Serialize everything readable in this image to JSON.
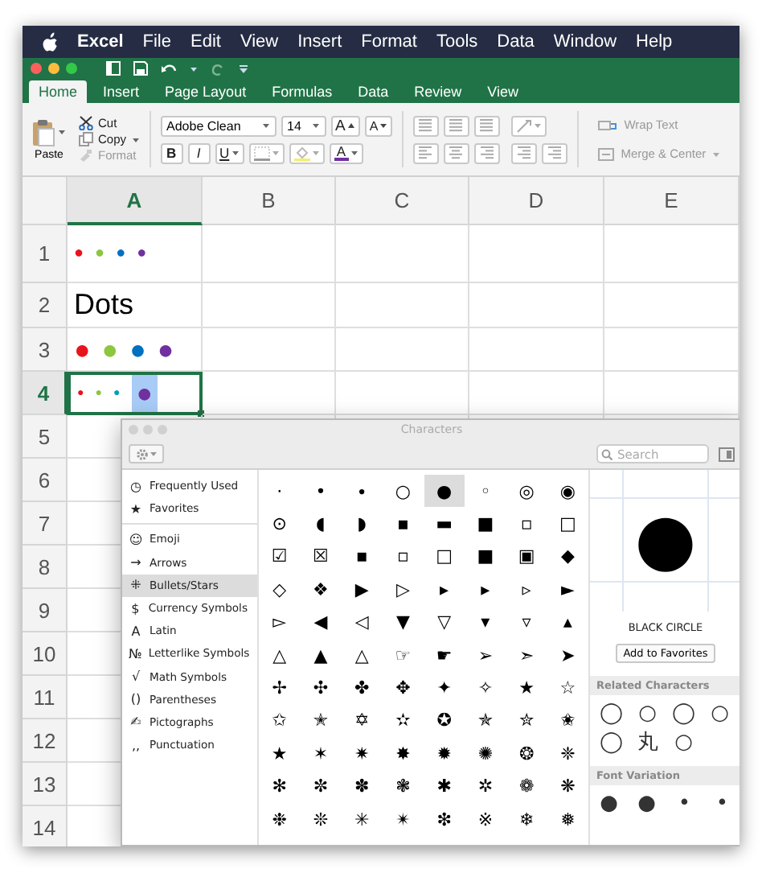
{
  "menu_bar": {
    "items": [
      {
        "label": "Excel",
        "kind": "app"
      },
      {
        "label": "File",
        "kind": "menu"
      },
      {
        "label": "Edit",
        "kind": "menu"
      },
      {
        "label": "View",
        "kind": "menu"
      },
      {
        "label": "Insert",
        "kind": "menu"
      },
      {
        "label": "Format",
        "kind": "menu"
      },
      {
        "label": "Tools",
        "kind": "menu"
      },
      {
        "label": "Data",
        "kind": "menu"
      },
      {
        "label": "Window",
        "kind": "menu"
      },
      {
        "label": "Help",
        "kind": "menu"
      }
    ]
  },
  "ribbon": {
    "tabs": [
      {
        "label": "Home",
        "selected": true
      },
      {
        "label": "Insert",
        "selected": false
      },
      {
        "label": "Page Layout",
        "selected": false
      },
      {
        "label": "Formulas",
        "selected": false
      },
      {
        "label": "Data",
        "selected": false
      },
      {
        "label": "Review",
        "selected": false
      },
      {
        "label": "View",
        "selected": false
      }
    ],
    "clipboard": {
      "paste": "Paste",
      "cut": "Cut",
      "copy": "Copy",
      "format": "Format"
    },
    "font": {
      "name": "Adobe Clean",
      "size": "14",
      "grow": "A",
      "shrink": "A",
      "bold": "B",
      "italic": "I",
      "underline": "U",
      "font_color": "A"
    },
    "wrap_text": "Wrap Text",
    "merge_center": "Merge & Center"
  },
  "sheet": {
    "columns": [
      {
        "label": "A",
        "selected": true
      },
      {
        "label": "B",
        "selected": false
      },
      {
        "label": "C",
        "selected": false
      },
      {
        "label": "D",
        "selected": false
      },
      {
        "label": "E",
        "selected": false
      }
    ],
    "rows": [
      {
        "label": "1",
        "selected": false,
        "cell": {
          "kind": "dots",
          "dots": [
            {
              "glyph": "●",
              "kind": "small",
              "color": "#e8141c"
            },
            {
              "glyph": "●",
              "kind": "small",
              "color": "#8dc63f"
            },
            {
              "glyph": "●",
              "kind": "small",
              "color": "#0070c0"
            },
            {
              "glyph": "●",
              "kind": "small",
              "color": "#7030a0"
            }
          ]
        }
      },
      {
        "label": "2",
        "selected": false,
        "cell": {
          "kind": "text",
          "text": "Dots"
        }
      },
      {
        "label": "3",
        "selected": false,
        "cell": {
          "kind": "dots",
          "dots": [
            {
              "glyph": "●",
              "kind": "large",
              "color": "#e8141c"
            },
            {
              "glyph": "●",
              "kind": "large",
              "color": "#8dc63f"
            },
            {
              "glyph": "●",
              "kind": "large",
              "color": "#0070c0"
            },
            {
              "glyph": "●",
              "kind": "large",
              "color": "#7030a0"
            }
          ]
        }
      },
      {
        "label": "4",
        "selected": true,
        "cell": {
          "kind": "dots",
          "dots": [
            {
              "glyph": "●",
              "kind": "tiny",
              "color": "#e8141c",
              "selected": false
            },
            {
              "glyph": "●",
              "kind": "tiny",
              "color": "#8dc63f",
              "selected": false
            },
            {
              "glyph": "●",
              "kind": "tiny",
              "color": "#00a0b8",
              "selected": false
            },
            {
              "glyph": "●",
              "kind": "large",
              "color": "#7030a0",
              "selected": true
            }
          ]
        }
      },
      {
        "label": "5",
        "selected": false
      },
      {
        "label": "6",
        "selected": false
      },
      {
        "label": "7",
        "selected": false
      },
      {
        "label": "8",
        "selected": false
      },
      {
        "label": "9",
        "selected": false
      },
      {
        "label": "10",
        "selected": false
      },
      {
        "label": "11",
        "selected": false
      },
      {
        "label": "12",
        "selected": false
      },
      {
        "label": "13",
        "selected": false
      },
      {
        "label": "14",
        "selected": false
      }
    ]
  },
  "characters": {
    "title": "Characters",
    "search_placeholder": "Search",
    "pinned": [
      {
        "icon": "◷",
        "label": "Frequently Used",
        "selected": false
      },
      {
        "icon": "★",
        "label": "Favorites",
        "selected": false
      }
    ],
    "categories": [
      {
        "icon": "☺",
        "label": "Emoji",
        "selected": false
      },
      {
        "icon": "→",
        "label": "Arrows",
        "selected": false
      },
      {
        "icon": "⁜",
        "label": "Bullets/Stars",
        "selected": true
      },
      {
        "icon": "$",
        "label": "Currency Symbols",
        "selected": false
      },
      {
        "icon": "A",
        "label": "Latin",
        "selected": false
      },
      {
        "icon": "№",
        "label": "Letterlike Symbols",
        "selected": false
      },
      {
        "icon": "√",
        "label": "Math Symbols",
        "selected": false
      },
      {
        "icon": "()",
        "label": "Parentheses",
        "selected": false
      },
      {
        "icon": "✍",
        "label": "Pictographs",
        "selected": false
      },
      {
        "icon": ",,",
        "label": "Punctuation",
        "selected": false
      }
    ],
    "grid": [
      [
        {
          "glyph": "·",
          "selected": false
        },
        {
          "glyph": "•",
          "selected": false
        },
        {
          "glyph": "∙",
          "selected": false
        },
        {
          "glyph": "○",
          "selected": false
        },
        {
          "glyph": "●",
          "selected": true
        },
        {
          "glyph": "◦",
          "selected": false
        },
        {
          "glyph": "◎",
          "selected": false
        },
        {
          "glyph": "◉",
          "selected": false
        }
      ],
      [
        {
          "glyph": "⊙",
          "selected": false
        },
        {
          "glyph": "◖",
          "selected": false
        },
        {
          "glyph": "◗",
          "selected": false
        },
        {
          "glyph": "▪",
          "selected": false
        },
        {
          "glyph": "▬",
          "selected": false
        },
        {
          "glyph": "■",
          "selected": false
        },
        {
          "glyph": "▫",
          "selected": false
        },
        {
          "glyph": "□",
          "selected": false
        }
      ],
      [
        {
          "glyph": "☑",
          "selected": false
        },
        {
          "glyph": "☒",
          "selected": false
        },
        {
          "glyph": "▪",
          "selected": false
        },
        {
          "glyph": "▫",
          "selected": false
        },
        {
          "glyph": "□",
          "selected": false
        },
        {
          "glyph": "■",
          "selected": false
        },
        {
          "glyph": "▣",
          "selected": false
        },
        {
          "glyph": "◆",
          "selected": false
        }
      ],
      [
        {
          "glyph": "◇",
          "selected": false
        },
        {
          "glyph": "❖",
          "selected": false
        },
        {
          "glyph": "▶",
          "selected": false
        },
        {
          "glyph": "▷",
          "selected": false
        },
        {
          "glyph": "▸",
          "selected": false
        },
        {
          "glyph": "▸",
          "selected": false
        },
        {
          "glyph": "▹",
          "selected": false
        },
        {
          "glyph": "►",
          "selected": false
        }
      ],
      [
        {
          "glyph": "▻",
          "selected": false
        },
        {
          "glyph": "◀",
          "selected": false
        },
        {
          "glyph": "◁",
          "selected": false
        },
        {
          "glyph": "▼",
          "selected": false
        },
        {
          "glyph": "▽",
          "selected": false
        },
        {
          "glyph": "▾",
          "selected": false
        },
        {
          "glyph": "▿",
          "selected": false
        },
        {
          "glyph": "▴",
          "selected": false
        }
      ],
      [
        {
          "glyph": "△",
          "selected": false
        },
        {
          "glyph": "▲",
          "selected": false
        },
        {
          "glyph": "△",
          "selected": false
        },
        {
          "glyph": "☞",
          "selected": false
        },
        {
          "glyph": "☛",
          "selected": false
        },
        {
          "glyph": "➢",
          "selected": false
        },
        {
          "glyph": "➣",
          "selected": false
        },
        {
          "glyph": "➤",
          "selected": false
        }
      ],
      [
        {
          "glyph": "✢",
          "selected": false
        },
        {
          "glyph": "✣",
          "selected": false
        },
        {
          "glyph": "✤",
          "selected": false
        },
        {
          "glyph": "✥",
          "selected": false
        },
        {
          "glyph": "✦",
          "selected": false
        },
        {
          "glyph": "✧",
          "selected": false
        },
        {
          "glyph": "★",
          "selected": false
        },
        {
          "glyph": "☆",
          "selected": false
        }
      ],
      [
        {
          "glyph": "✩",
          "selected": false
        },
        {
          "glyph": "✭",
          "selected": false
        },
        {
          "glyph": "✡",
          "selected": false
        },
        {
          "glyph": "✫",
          "selected": false
        },
        {
          "glyph": "✪",
          "selected": false
        },
        {
          "glyph": "✯",
          "selected": false
        },
        {
          "glyph": "✮",
          "selected": false
        },
        {
          "glyph": "✬",
          "selected": false
        }
      ],
      [
        {
          "glyph": "★",
          "selected": false
        },
        {
          "glyph": "✶",
          "selected": false
        },
        {
          "glyph": "✷",
          "selected": false
        },
        {
          "glyph": "✸",
          "selected": false
        },
        {
          "glyph": "✹",
          "selected": false
        },
        {
          "glyph": "✺",
          "selected": false
        },
        {
          "glyph": "❂",
          "selected": false
        },
        {
          "glyph": "❈",
          "selected": false
        }
      ],
      [
        {
          "glyph": "✻",
          "selected": false
        },
        {
          "glyph": "✼",
          "selected": false
        },
        {
          "glyph": "✽",
          "selected": false
        },
        {
          "glyph": "❃",
          "selected": false
        },
        {
          "glyph": "✱",
          "selected": false
        },
        {
          "glyph": "✲",
          "selected": false
        },
        {
          "glyph": "❁",
          "selected": false
        },
        {
          "glyph": "❋",
          "selected": false
        }
      ],
      [
        {
          "glyph": "❉",
          "selected": false
        },
        {
          "glyph": "❊",
          "selected": false
        },
        {
          "glyph": "✳",
          "selected": false
        },
        {
          "glyph": "✴",
          "selected": false
        },
        {
          "glyph": "❇",
          "selected": false
        },
        {
          "glyph": "※",
          "selected": false
        },
        {
          "glyph": "❄",
          "selected": false
        },
        {
          "glyph": "❅",
          "selected": false
        }
      ]
    ],
    "preview": {
      "glyph": "●",
      "name": "BLACK CIRCLE"
    },
    "add_button": "Add to Favorites",
    "related": {
      "title": "Related Characters",
      "glyphs": [
        "◯",
        "○",
        "◯",
        "○",
        "◯",
        "丸",
        "○"
      ]
    },
    "font_variation": {
      "title": "Font Variation",
      "glyphs": [
        "●",
        "●",
        "•",
        "•"
      ]
    }
  }
}
